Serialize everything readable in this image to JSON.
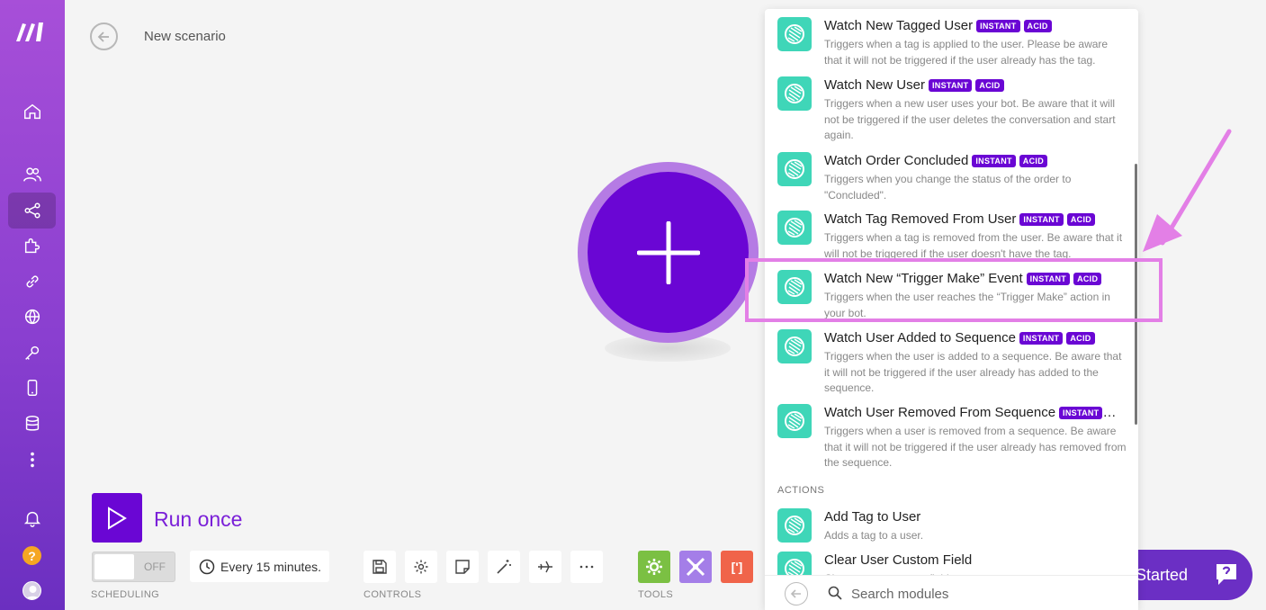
{
  "header": {
    "title": "New scenario"
  },
  "run": {
    "label": "Run once"
  },
  "scheduling": {
    "toggle": "OFF",
    "interval": "Every 15 minutes.",
    "label": "SCHEDULING"
  },
  "controls": {
    "label": "CONTROLS"
  },
  "tools": {
    "label": "TOOLS"
  },
  "get_started": {
    "label": "Started"
  },
  "panel": {
    "modules": [
      {
        "title": "Watch New Tagged User",
        "badges": [
          "INSTANT",
          "ACID"
        ],
        "desc": "Triggers when a tag is applied to the user. Please be aware that it will not be triggered if the user already has the tag."
      },
      {
        "title": "Watch New User",
        "badges": [
          "INSTANT",
          "ACID"
        ],
        "desc": "Triggers when a new user uses your bot. Be aware that it will not be triggered if the user deletes the conversation and start again."
      },
      {
        "title": "Watch Order Concluded",
        "badges": [
          "INSTANT",
          "ACID"
        ],
        "desc": "Triggers when you change the status of the order to \"Concluded\"."
      },
      {
        "title": "Watch Tag Removed From User",
        "badges": [
          "INSTANT",
          "ACID"
        ],
        "desc": "Triggers when a tag is removed from the user. Be aware that it will not be triggered if the user doesn't have the tag."
      },
      {
        "title": "Watch New “Trigger Make” Event",
        "badges": [
          "INSTANT",
          "ACID"
        ],
        "desc": "Triggers when the user reaches the “Trigger Make” action in your bot."
      },
      {
        "title": "Watch User Added to Sequence",
        "badges": [
          "INSTANT",
          "ACID"
        ],
        "desc": "Triggers when the user is added to a sequence. Be aware that it will not be triggered if the user already has added to the sequence."
      },
      {
        "title": "Watch User Removed From Sequence",
        "badges": [
          "INSTANT"
        ],
        "desc": "Triggers when a user is removed from a sequence. Be aware that it will not be triggered if the user already has removed from the sequence."
      }
    ],
    "section_actions": "ACTIONS",
    "actions": [
      {
        "title": "Add Tag to User",
        "desc": "Adds a tag to a user."
      },
      {
        "title": "Clear User Custom Field",
        "desc": "Clears a user custom field."
      }
    ],
    "search_placeholder": "Search modules"
  },
  "colors": {
    "brand": "#6a06d4",
    "module_icon": "#3fd6b8",
    "highlight": "#e37fe6",
    "sidebar": "#8a3fd0"
  }
}
